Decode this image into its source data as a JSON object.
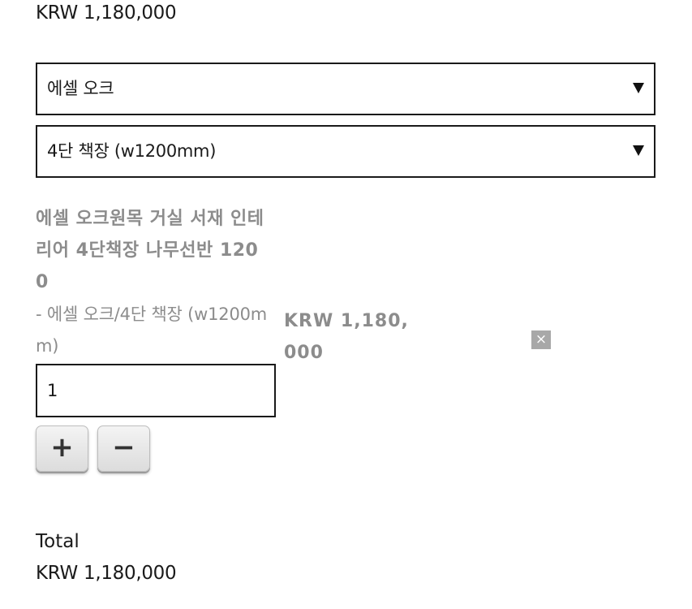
{
  "product": {
    "price": "KRW 1,180,000"
  },
  "options": {
    "color_select": {
      "selected": "에셀 오크"
    },
    "type_select": {
      "selected": "4단 책장 (w1200mm)"
    }
  },
  "selected_item": {
    "name": "에셀 오크원목 거실 서재 인테리어 4단책장 나무선반 1200",
    "option_text": "- 에셀 오크/4단 책장 (w1200mm)",
    "quantity": "1",
    "price": "KRW 1,180,000",
    "plus_label": "+",
    "minus_label": "−",
    "delete_label": "×"
  },
  "total": {
    "label": "Total",
    "price": "KRW 1,180,000"
  },
  "colors": {
    "text_primary": "#1a1a1a",
    "text_muted": "#8c8c8c",
    "delete_bg": "#a8a8a8"
  }
}
